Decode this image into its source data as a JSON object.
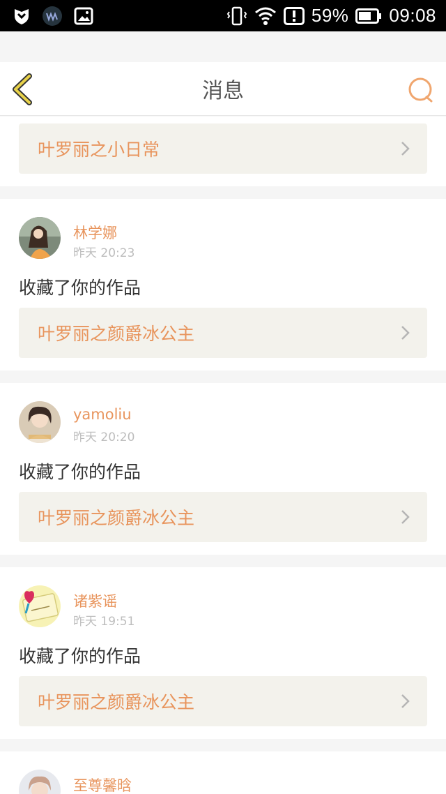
{
  "status_bar": {
    "battery": "59%",
    "time": "09:08"
  },
  "header": {
    "title": "消息"
  },
  "top_card": {
    "work_title": "叶罗丽之小日常"
  },
  "messages": [
    {
      "name": "林学娜",
      "time": "昨天 20:23",
      "action": "收藏了你的作品",
      "work_title": "叶罗丽之颜爵冰公主"
    },
    {
      "name": "yamoliu",
      "time": "昨天 20:20",
      "action": "收藏了你的作品",
      "work_title": "叶罗丽之颜爵冰公主"
    },
    {
      "name": "诸紫谣",
      "time": "昨天 19:51",
      "action": "收藏了你的作品",
      "work_title": "叶罗丽之颜爵冰公主"
    },
    {
      "name": "至尊馨晗"
    }
  ],
  "colors": {
    "accent": "#e8945c",
    "back_icon": "#e0c33c",
    "bar_bg": "#f3f2ec"
  }
}
